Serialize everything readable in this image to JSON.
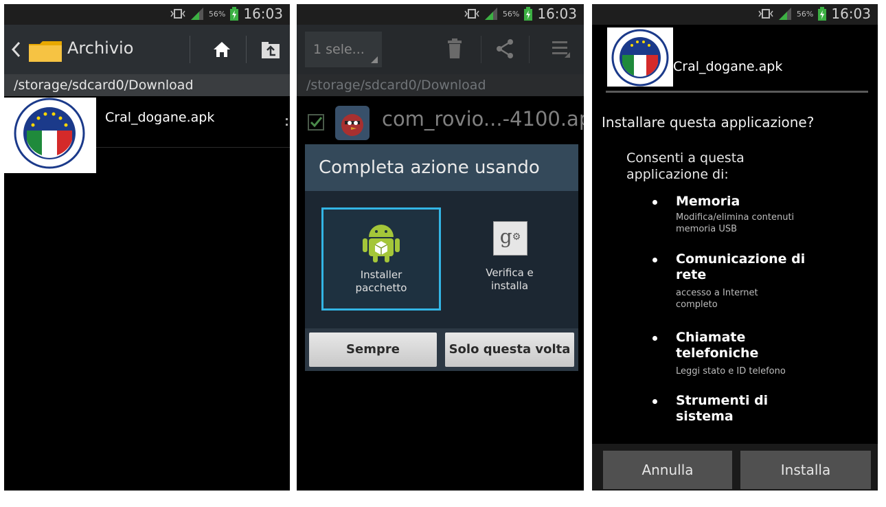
{
  "statusbar": {
    "time": "16:03",
    "battery": "56%"
  },
  "panel1": {
    "title": "Archivio",
    "path": "/storage/sdcard0/Download",
    "file_name": "Cral_dogane.apk"
  },
  "panel2": {
    "selection": "1 sele...",
    "path": "/storage/sdcard0/Download",
    "file_name": "com_rovio...-4100.apk",
    "dialog": {
      "title": "Completa azione usando",
      "options": [
        {
          "label": "Installer pacchetto",
          "icon": "android-installer-icon"
        },
        {
          "label": "Verifica e installa",
          "icon": "google-settings-icon"
        }
      ],
      "buttons": {
        "always": "Sempre",
        "once": "Solo questa volta"
      }
    }
  },
  "panel3": {
    "app_name": "Cral_dogane.apk",
    "question": "Installare questa applicazione?",
    "consent": "Consenti a questa applicazione di:",
    "permissions": [
      {
        "title": "Memoria",
        "desc": "Modifica/elimina contenuti memoria USB"
      },
      {
        "title": "Comunicazione di rete",
        "desc": "accesso a Internet completo"
      },
      {
        "title": "Chiamate telefoniche",
        "desc": "Leggi stato e ID telefono"
      },
      {
        "title": "Strumenti di sistema",
        "desc": ""
      }
    ],
    "buttons": {
      "cancel": "Annulla",
      "install": "Installa"
    }
  },
  "colors": {
    "accent": "#33b5e5",
    "dialog_title": "#34495a",
    "actionbar": "#2b2f33"
  }
}
